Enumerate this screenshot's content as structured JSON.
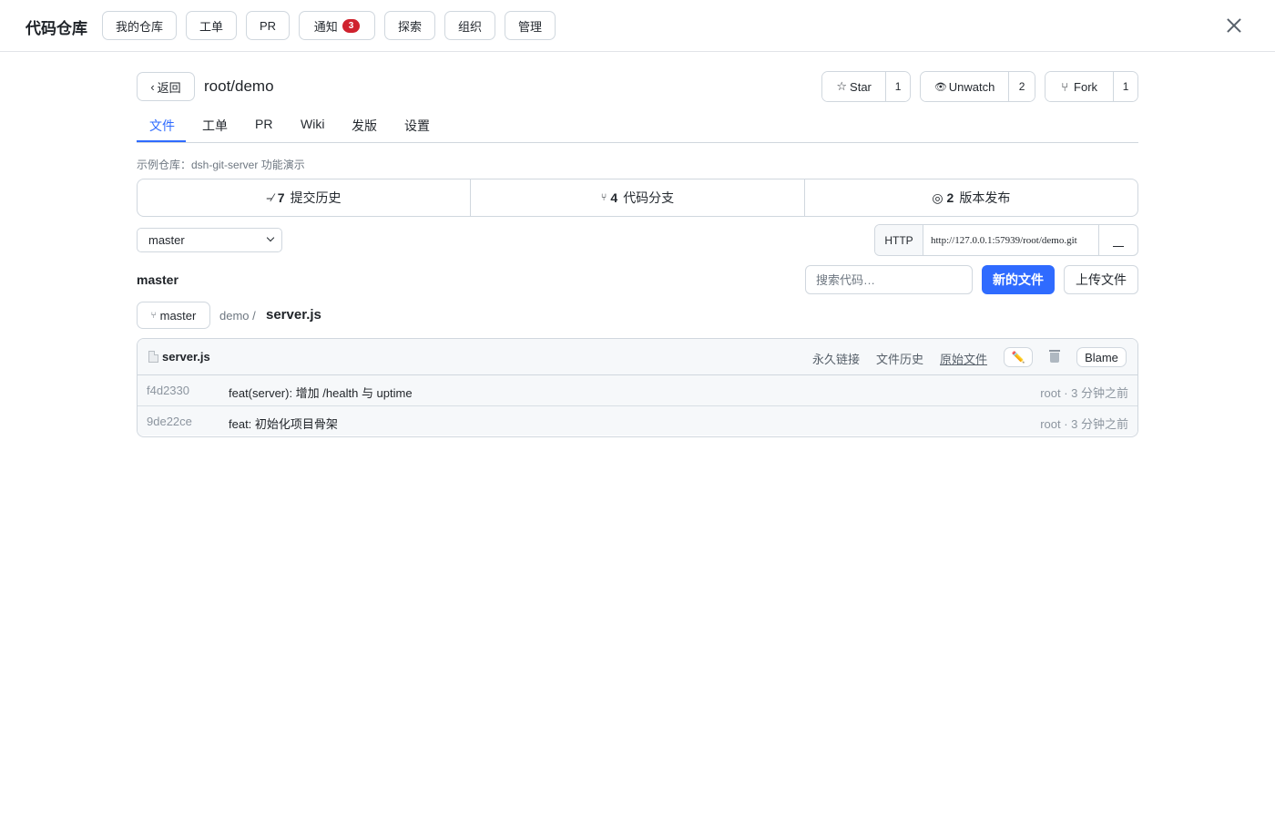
{
  "app": {
    "brand": "代码仓库"
  },
  "nav": {
    "items": [
      {
        "label": "我的仓库"
      },
      {
        "label": "工单"
      },
      {
        "label": "PR"
      },
      {
        "label": "通知",
        "badge": "3"
      },
      {
        "label": "探索"
      },
      {
        "label": "组织"
      },
      {
        "label": "管理"
      }
    ]
  },
  "repo": {
    "back_label": "返回",
    "back_icon": "‹",
    "title": "root/demo",
    "star": {
      "label": "Star",
      "icon": "☆",
      "count": "1"
    },
    "watch": {
      "label": "Unwatch",
      "icon": "👁",
      "count": "2"
    },
    "fork": {
      "label": "Fork",
      "icon": "⑂",
      "count": "1"
    },
    "tabs": [
      {
        "label": "文件",
        "active": true
      },
      {
        "label": "工单"
      },
      {
        "label": "PR"
      },
      {
        "label": "Wiki"
      },
      {
        "label": "发版"
      },
      {
        "label": "设置"
      }
    ],
    "description": "示例仓库：dsh-git-server 功能演示",
    "stats": [
      {
        "icon": "⎯⁄",
        "value": "7",
        "label": "提交历史"
      },
      {
        "icon": "⑂",
        "value": "4",
        "label": "代码分支"
      },
      {
        "icon": "◎",
        "value": "2",
        "label": "版本发布"
      }
    ]
  },
  "branch": {
    "selected": "master",
    "label": "master"
  },
  "clone": {
    "protocol": "HTTP",
    "url": "http://127.0.0.1:57939/root/demo.git"
  },
  "actions": {
    "search_placeholder": "搜索代码…",
    "new_file": "新的文件",
    "upload_file": "上传文件"
  },
  "breadcrumb": {
    "branch_icon": "⑂",
    "branch": "master",
    "dir": "demo /",
    "file": "server.js"
  },
  "file": {
    "name": "server.js",
    "permalink": "永久链接",
    "history": "文件历史",
    "raw": "原始文件",
    "edit_icon": "✏️",
    "blame": "Blame",
    "commits": [
      {
        "sha": "f4d2330",
        "message": "feat(server): 增加 /health 与 uptime",
        "meta": "root · 3 分钟之前"
      },
      {
        "sha": "9de22ce",
        "message": "feat: 初始化项目骨架",
        "meta": "root · 3 分钟之前"
      }
    ]
  },
  "colors": {
    "accent": "#2f6bff",
    "badge": "#cf222e",
    "border": "#d0d7de"
  }
}
